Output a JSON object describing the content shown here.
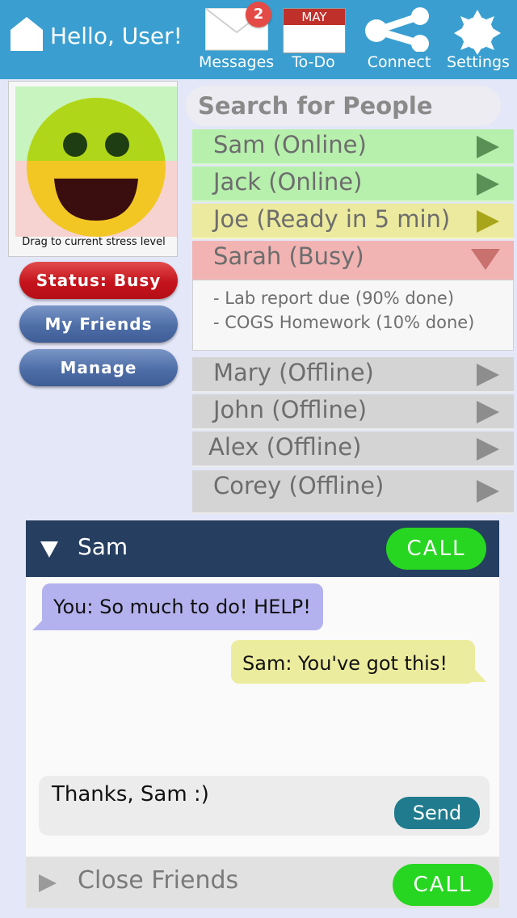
{
  "header": {
    "greeting": "Hello, User!",
    "nav": [
      {
        "label": "Messages",
        "icon": "envelope-icon",
        "badge": "2"
      },
      {
        "label": "To-Do",
        "icon": "calendar-icon",
        "month": "MAY"
      },
      {
        "label": "Connect",
        "icon": "share-icon"
      },
      {
        "label": "Settings",
        "icon": "gear-icon"
      }
    ]
  },
  "stress": {
    "caption": "Drag to current stress level",
    "colors": {
      "calm": "#c8f4c0",
      "stressed": "#f6d2d0",
      "face": "#f2c724"
    }
  },
  "sidebar": {
    "status_label": "Status: Busy",
    "friends_label": "My Friends",
    "manage_label": "Manage"
  },
  "search": {
    "placeholder": "Search for People"
  },
  "people": [
    {
      "name": "Sam (Online)",
      "state": "online",
      "color": "#b7f0ad"
    },
    {
      "name": "Jack (Online)",
      "state": "online",
      "color": "#b7f0ad"
    },
    {
      "name": "Joe (Ready in 5 min)",
      "state": "ready",
      "color": "#ecea9e"
    },
    {
      "name": "Sarah (Busy)",
      "state": "busy",
      "color": "#f1b4b3",
      "expanded": true,
      "details": [
        "- Lab report due (90% done)",
        "- COGS Homework (10% done)"
      ]
    },
    {
      "name": "Mary (Offline)",
      "state": "offline",
      "color": "#d4d4d4"
    },
    {
      "name": "John (Offline)",
      "state": "offline",
      "color": "#d4d4d4"
    },
    {
      "name": "Alex (Offline)",
      "state": "offline",
      "color": "#d4d4d4"
    },
    {
      "name": "Corey (Offline)",
      "state": "offline",
      "color": "#d4d4d4"
    }
  ],
  "chat": {
    "contact": "Sam",
    "call_label": "CALL",
    "messages": [
      {
        "sender": "me",
        "text": "You: So much to do! HELP!"
      },
      {
        "sender": "them",
        "text": "Sam: You've got this!"
      }
    ],
    "draft": "Thanks, Sam :)",
    "send_label": "Send"
  },
  "groups": [
    {
      "name": "Close Friends",
      "call_label": "CALL"
    }
  ]
}
